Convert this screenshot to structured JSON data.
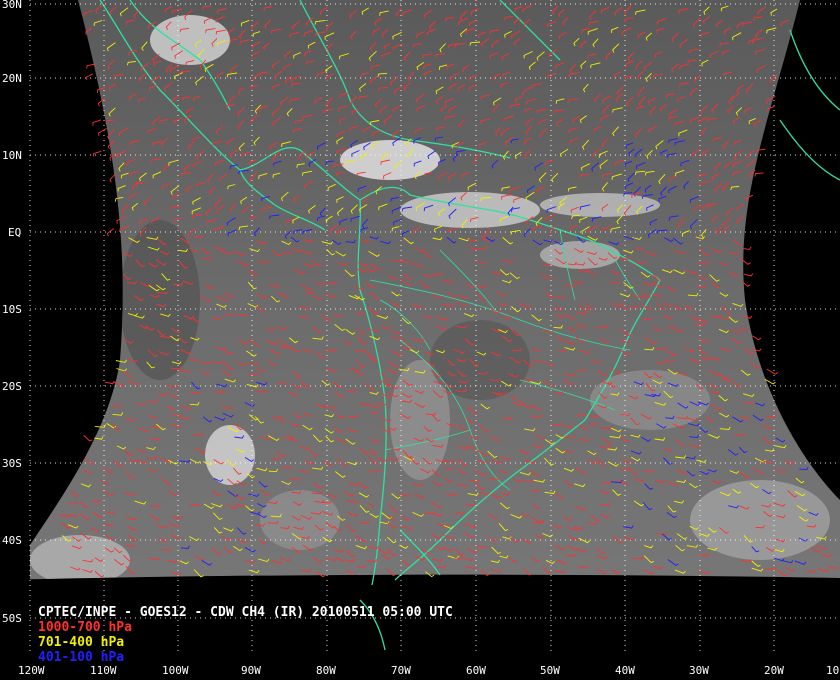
{
  "header": {
    "title": "CPTEC/INPE - GOES12 - CDW CH4 (IR) 20100511 05:00 UTC"
  },
  "legend": [
    {
      "label": "1000-700 hPa",
      "color": "#ff3030"
    },
    {
      "label": "701-400 hPa",
      "color": "#f0f000"
    },
    {
      "label": "401-100 hPa",
      "color": "#2020ff"
    }
  ],
  "axes": {
    "lat_labels": [
      "30N",
      "20N",
      "10N",
      "EQ",
      "10S",
      "20S",
      "30S",
      "40S",
      "50S"
    ],
    "lon_labels": [
      "120W",
      "110W",
      "100W",
      "90W",
      "80W",
      "70W",
      "60W",
      "50W",
      "40W",
      "30W",
      "20W",
      "10"
    ]
  },
  "colors": {
    "background": "#000000",
    "coastline": "#30e0a0",
    "grid": "#ffffff",
    "imagery": "#6a6a6a"
  }
}
